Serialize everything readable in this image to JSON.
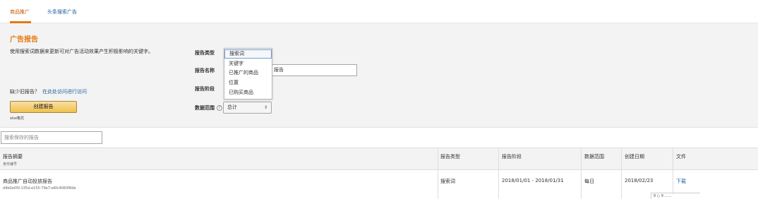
{
  "tabs": [
    {
      "label": "商品推广",
      "active": true
    },
    {
      "label": "头条搜索广告",
      "active": false
    }
  ],
  "panel": {
    "title": "广告报告",
    "description": "使用搜索词数据来更新可对广告活动效果产生积极影响的关键字。",
    "old_reports_text": "缺少旧报告？",
    "old_reports_link": "在此处访问进行访问",
    "create_button": "创建报告",
    "xlsx_note": "xlsx格式"
  },
  "form": {
    "type_label": "报告类型",
    "name_label": "报告名称",
    "period_label": "报告阶段",
    "range_label": "数据范围",
    "name_value": "报告",
    "range_value": "总计",
    "dropdown_options": [
      "搜索词",
      "关键字",
      "已推广的商品",
      "位置",
      "已购买商品"
    ],
    "selected_option": "搜索词"
  },
  "search": {
    "placeholder": "搜索保存的报告"
  },
  "table": {
    "headers": {
      "name": "报告摘要",
      "name_sub": "身份编号",
      "type": "报告类型",
      "period": "报告阶段",
      "range": "数据范围",
      "created": "创建日期",
      "file": "文件"
    },
    "rows": [
      {
        "name": "商品推广自动投放报告",
        "id": "d4b0e05f-135d-e155-79e7-e6fc4083f8db",
        "type": "搜索词",
        "period": "2018/01/01 - 2018/01/31",
        "range": "每日",
        "created": "2018/02/23",
        "file": "下载"
      }
    ]
  },
  "corner_text": "8 ○ 9 ……",
  "colors": {
    "accent": "#e47911",
    "link": "#1f5f9c",
    "button": "#f0c14b",
    "panel_bg": "#f3f3f3"
  }
}
